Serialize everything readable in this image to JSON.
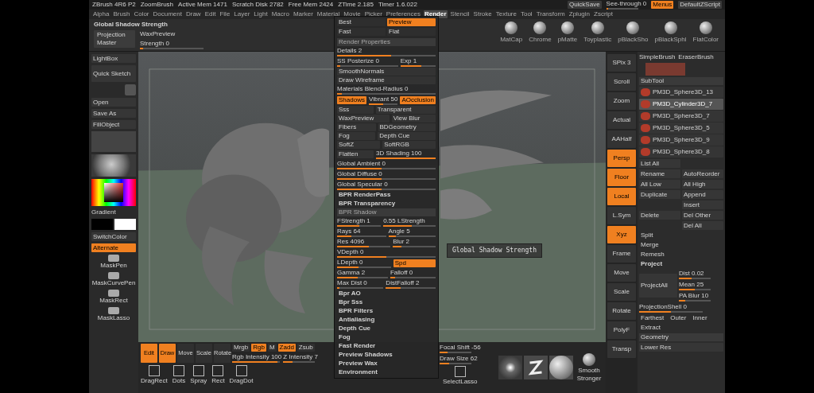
{
  "title_bar": {
    "app": "ZBrush 4R6 P2",
    "document": "ZoomBrush",
    "stats": [
      "Active Mem 1471",
      "Scratch Disk 2782",
      "Free Mem 2424",
      "ZTime 2.185",
      "Timer 1.6.022"
    ],
    "quicksave": "QuickSave",
    "see_through": {
      "label": "See-through 0",
      "level": 0.05
    },
    "menus": {
      "label": "Menus",
      "on": true
    },
    "script": "DefaultZScript"
  },
  "menu_bar": [
    {
      "label": "Alpha",
      "selected": false
    },
    {
      "label": "Brush",
      "selected": false
    },
    {
      "label": "Color",
      "selected": false
    },
    {
      "label": "Document",
      "selected": false
    },
    {
      "label": "Draw",
      "selected": false
    },
    {
      "label": "Edit",
      "selected": false
    },
    {
      "label": "File",
      "selected": false
    },
    {
      "label": "Layer",
      "selected": false
    },
    {
      "label": "Light",
      "selected": false
    },
    {
      "label": "Macro",
      "selected": false
    },
    {
      "label": "Marker",
      "selected": false
    },
    {
      "label": "Material",
      "selected": false
    },
    {
      "label": "Movie",
      "selected": false
    },
    {
      "label": "Picker",
      "selected": false
    },
    {
      "label": "Preferences",
      "selected": false
    },
    {
      "label": "Render",
      "selected": true
    },
    {
      "label": "Stencil",
      "selected": false
    },
    {
      "label": "Stroke",
      "selected": false
    },
    {
      "label": "Texture",
      "selected": false
    },
    {
      "label": "Tool",
      "selected": false
    },
    {
      "label": "Transform",
      "selected": false
    },
    {
      "label": "Zplugin",
      "selected": false
    },
    {
      "label": "Zscript",
      "selected": false
    }
  ],
  "toolbar": {
    "title": "Global Shadow Strength",
    "projection_master": "Projection Master",
    "wax_preview": "WaxPreview",
    "strength": {
      "label": "Strength 0",
      "level": 0.05
    },
    "materials": [
      "MatCap",
      "Chrome",
      "pMatte",
      "Toyplastic",
      "pBlackSho",
      "pBlackSphl",
      "FlatColor"
    ]
  },
  "left_shelf": {
    "lightbox": "LightBox",
    "quick_sketch": "Quick Sketch",
    "open": "Open",
    "save_as": "Save As",
    "fill_object": "FillObject",
    "gradient": "Gradient",
    "switch_color": "SwitchColor",
    "alternate": {
      "label": "Alternate",
      "on": true
    },
    "brushes": [
      "MaskPen",
      "MaskCurvePen",
      "MaskRect",
      "MaskLasso"
    ]
  },
  "render_menu": {
    "modes": [
      {
        "label": "Best",
        "selected": false
      },
      {
        "label": "Preview",
        "selected": true
      },
      {
        "label": "Fast",
        "selected": false
      },
      {
        "label": "Flat",
        "selected": false
      }
    ],
    "rows": [
      [
        {
          "kind": "header",
          "label": "Render Properties"
        }
      ],
      [
        {
          "kind": "slider",
          "label": "Details 2",
          "level": 0.55
        }
      ],
      [
        {
          "kind": "slider",
          "label": "SS Posterize 0",
          "level": 0.05
        },
        {
          "kind": "slider",
          "label": "Exp 1",
          "level": 0.6
        }
      ],
      [
        {
          "kind": "toggle",
          "label": "SmoothNormals",
          "on": false
        }
      ],
      [
        {
          "kind": "toggle",
          "label": "Draw Wireframe",
          "on": false
        }
      ],
      [
        {
          "kind": "slider",
          "label": "Materials Blend-Radius 0",
          "level": 0.05
        }
      ],
      [
        {
          "kind": "toggle",
          "label": "Shadows",
          "on": true
        },
        {
          "kind": "slider",
          "label": "Vibrant 50",
          "level": 0.5
        },
        {
          "kind": "toggle",
          "label": "AOcclusion",
          "on": true
        }
      ],
      [
        {
          "kind": "toggle",
          "label": "Sss",
          "on": false
        },
        {
          "kind": "toggle",
          "label": "Transparent",
          "on": false
        }
      ],
      [
        {
          "kind": "toggle",
          "label": "WaxPreview",
          "on": false
        },
        {
          "kind": "toggle",
          "label": "View Blur",
          "on": false
        }
      ],
      [
        {
          "kind": "toggle",
          "label": "Fibers",
          "on": false
        },
        {
          "kind": "toggle",
          "label": "BDGeometry",
          "on": false
        }
      ],
      [
        {
          "kind": "toggle",
          "label": "Fog",
          "on": false
        },
        {
          "kind": "toggle",
          "label": "Depth Cue",
          "on": false
        }
      ],
      [
        {
          "kind": "toggle",
          "label": "SoftZ",
          "on": false
        },
        {
          "kind": "toggle",
          "label": "SoftRGB",
          "on": false
        }
      ],
      [
        {
          "kind": "toggle",
          "label": "Flatten",
          "on": false
        },
        {
          "kind": "slider",
          "label": "3D Shading 100",
          "level": 1
        }
      ],
      [
        {
          "kind": "slider",
          "label": "Global Ambient 0",
          "level": 0.45
        }
      ],
      [
        {
          "kind": "slider",
          "label": "Global Diffuse 0",
          "level": 0.45
        }
      ],
      [
        {
          "kind": "slider",
          "label": "Global Specular 0",
          "level": 0.45
        }
      ],
      [
        {
          "kind": "section",
          "label": "BPR RenderPass"
        }
      ],
      [
        {
          "kind": "section",
          "label": "BPR Transparency"
        }
      ],
      [
        {
          "kind": "header",
          "label": "BPR Shadow"
        }
      ],
      [
        {
          "kind": "slider",
          "label": "FStrength 1",
          "level": 0.5
        },
        {
          "kind": "slider",
          "label": "0.55 LStrength",
          "level": 0.55
        }
      ],
      [
        {
          "kind": "slider",
          "label": "Rays 64",
          "level": 0.3
        },
        {
          "kind": "slider",
          "label": "Angle 5",
          "level": 0.15
        }
      ],
      [
        {
          "kind": "slider",
          "label": "Res 4096",
          "level": 0.6
        },
        {
          "kind": "slider",
          "label": "Blur 2",
          "level": 0.2
        }
      ],
      [
        {
          "kind": "slider",
          "label": "VDepth 0",
          "level": 0.5
        }
      ],
      [
        {
          "kind": "slider",
          "label": "LDepth 0",
          "level": 0.4
        },
        {
          "kind": "toggle",
          "label": "Spd",
          "on": true
        }
      ],
      [
        {
          "kind": "slider",
          "label": "Gamma 2",
          "level": 0.4
        },
        {
          "kind": "slider",
          "label": "Falloff 0",
          "level": 0.1
        }
      ],
      [
        {
          "kind": "slider",
          "label": "Max Dist 0",
          "level": 0.05
        },
        {
          "kind": "slider",
          "label": "DistFalloff 2",
          "level": 0.3
        }
      ],
      [
        {
          "kind": "section",
          "label": "Bpr AO"
        }
      ],
      [
        {
          "kind": "section",
          "label": "Bpr Sss"
        }
      ],
      [
        {
          "kind": "section",
          "label": "BPR Filters"
        }
      ],
      [
        {
          "kind": "section",
          "label": "Antialiasing"
        }
      ],
      [
        {
          "kind": "section",
          "label": "Depth Cue"
        }
      ],
      [
        {
          "kind": "section",
          "label": "Fog"
        }
      ],
      [
        {
          "kind": "section",
          "label": "Fast Render"
        }
      ],
      [
        {
          "kind": "section",
          "label": "Preview Shadows"
        }
      ],
      [
        {
          "kind": "section",
          "label": "Preview Wax"
        }
      ],
      [
        {
          "kind": "section",
          "label": "Environment"
        }
      ]
    ]
  },
  "tooltip": "Global Shadow Strength",
  "bottom_bar": {
    "modes": [
      {
        "label": "Edit",
        "on": true
      },
      {
        "label": "Draw",
        "on": true
      },
      {
        "label": "Move",
        "on": false
      },
      {
        "label": "Scale",
        "on": false
      },
      {
        "label": "Rotate",
        "on": false
      }
    ],
    "color_modes": [
      {
        "label": "Mrgb",
        "on": false
      },
      {
        "label": "Rgb",
        "on": true
      },
      {
        "label": "M",
        "on": false
      }
    ],
    "z_modes": [
      {
        "label": "Zadd",
        "on": true
      },
      {
        "label": "Zsub",
        "on": false
      }
    ],
    "rgb_intensity": {
      "label": "Rgb Intensity 100",
      "level": 0.95
    },
    "z_intensity": {
      "label": "Z Intensity 7",
      "level": 0.3
    },
    "focal_shift": {
      "label": "Focal Shift -56",
      "level": 0.25
    },
    "draw_size": {
      "label": "Draw Size 62",
      "level": 0.3
    },
    "strokes": [
      "DragRect",
      "Dots",
      "Spray",
      "Rect",
      "DragDot"
    ],
    "select": "SelectLasso",
    "smooth_brush": "Smooth Stronger"
  },
  "right_shelf": [
    {
      "label": "SPix 3",
      "on": false
    },
    {
      "label": "Scroll",
      "on": false
    },
    {
      "label": "Zoom",
      "on": false
    },
    {
      "label": "Actual",
      "on": false
    },
    {
      "label": "AAHalf",
      "on": false
    },
    {
      "label": "Persp",
      "on": true
    },
    {
      "label": "Floor",
      "on": true
    },
    {
      "label": "Local",
      "on": true
    },
    {
      "label": "L.Sym",
      "on": false
    },
    {
      "label": "Xyz",
      "on": true
    },
    {
      "label": "Frame",
      "on": false
    },
    {
      "label": "Move",
      "on": false
    },
    {
      "label": "Scale",
      "on": false
    },
    {
      "label": "Rotate",
      "on": false
    },
    {
      "label": "PolyF",
      "on": false
    },
    {
      "label": "Transp",
      "on": false
    }
  ],
  "right_panel": {
    "brushes": [
      "SimpleBrush",
      "EraserBrush"
    ],
    "subtool_title": "SubTool",
    "subtools": [
      {
        "name": "PM3D_Sphere3D_13",
        "selected": false
      },
      {
        "name": "PM3D_Cylinder3D_7",
        "selected": true
      },
      {
        "name": "PM3D_Sphere3D_7",
        "selected": false
      },
      {
        "name": "PM3D_Sphere3D_5",
        "selected": false
      },
      {
        "name": "PM3D_Sphere3D_9",
        "selected": false
      },
      {
        "name": "PM3D_Sphere3D_8",
        "selected": false
      }
    ],
    "list_all": "List All",
    "rename": "Rename",
    "auto_reorder": "AutoReorder",
    "all_low": "All Low",
    "all_high": "All High",
    "duplicate": "Duplicate",
    "append": "Append",
    "insert": "Insert",
    "delete": "Delete",
    "del_other": "Del Other",
    "del_all": "Del All",
    "split": "Split",
    "merge": "Merge",
    "remesh": "Remesh",
    "project": "Project",
    "project_all": "ProjectAll",
    "project_sliders": [
      {
        "label": "Dist 0.02",
        "level": 0.4
      },
      {
        "label": "Mean 25",
        "level": 0.5
      },
      {
        "label": "PA Blur 10",
        "level": 0.2
      }
    ],
    "projection_shell": {
      "label": "ProjectionShell 0",
      "level": 0.5
    },
    "shell_options": [
      "Farthest",
      "Outer",
      "Inner"
    ],
    "extract": "Extract",
    "geometry": "Geometry",
    "lower_res": "Lower Res"
  }
}
